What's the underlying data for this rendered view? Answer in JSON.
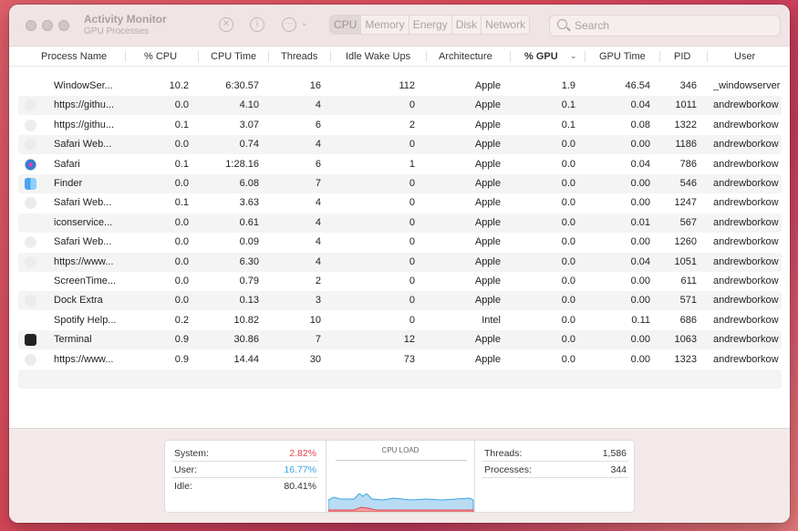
{
  "window": {
    "title": "Activity Monitor",
    "subtitle": "GPU Processes"
  },
  "toolbar": {
    "stop_icon": "x-circle-icon",
    "info_icon": "info-icon",
    "more_icon": "ellipsis-circle-icon",
    "tabs": [
      {
        "label": "CPU",
        "active": true
      },
      {
        "label": "Memory"
      },
      {
        "label": "Energy"
      },
      {
        "label": "Disk"
      },
      {
        "label": "Network"
      }
    ],
    "search_placeholder": "Search"
  },
  "columns": [
    "Process Name",
    "% CPU",
    "CPU Time",
    "Threads",
    "Idle Wake Ups",
    "Architecture",
    "% GPU",
    "GPU Time",
    "PID",
    "User"
  ],
  "sort_column": "% GPU",
  "rows": [
    {
      "icon": "none",
      "name": "WindowSer...",
      "cpu": "10.2",
      "cpu_time": "6:30.57",
      "threads": "16",
      "idle": "112",
      "arch": "Apple",
      "gpu": "1.9",
      "gpu_time": "46.54",
      "pid": "346",
      "user": "_windowserver"
    },
    {
      "icon": "generic-app-icon",
      "name": "https://githu...",
      "cpu": "0.0",
      "cpu_time": "4.10",
      "threads": "4",
      "idle": "0",
      "arch": "Apple",
      "gpu": "0.1",
      "gpu_time": "0.04",
      "pid": "1011",
      "user": "andrewborkow"
    },
    {
      "icon": "generic-app-icon",
      "name": "https://githu...",
      "cpu": "0.1",
      "cpu_time": "3.07",
      "threads": "6",
      "idle": "2",
      "arch": "Apple",
      "gpu": "0.1",
      "gpu_time": "0.08",
      "pid": "1322",
      "user": "andrewborkow"
    },
    {
      "icon": "generic-app-icon",
      "name": "Safari Web...",
      "cpu": "0.0",
      "cpu_time": "0.74",
      "threads": "4",
      "idle": "0",
      "arch": "Apple",
      "gpu": "0.0",
      "gpu_time": "0.00",
      "pid": "1186",
      "user": "andrewborkow"
    },
    {
      "icon": "safari-icon",
      "name": "Safari",
      "cpu": "0.1",
      "cpu_time": "1:28.16",
      "threads": "6",
      "idle": "1",
      "arch": "Apple",
      "gpu": "0.0",
      "gpu_time": "0.04",
      "pid": "786",
      "user": "andrewborkow"
    },
    {
      "icon": "finder-icon",
      "name": "Finder",
      "cpu": "0.0",
      "cpu_time": "6.08",
      "threads": "7",
      "idle": "0",
      "arch": "Apple",
      "gpu": "0.0",
      "gpu_time": "0.00",
      "pid": "546",
      "user": "andrewborkow"
    },
    {
      "icon": "generic-app-icon",
      "name": "Safari Web...",
      "cpu": "0.1",
      "cpu_time": "3.63",
      "threads": "4",
      "idle": "0",
      "arch": "Apple",
      "gpu": "0.0",
      "gpu_time": "0.00",
      "pid": "1247",
      "user": "andrewborkow"
    },
    {
      "icon": "none",
      "name": "iconservice...",
      "cpu": "0.0",
      "cpu_time": "0.61",
      "threads": "4",
      "idle": "0",
      "arch": "Apple",
      "gpu": "0.0",
      "gpu_time": "0.01",
      "pid": "567",
      "user": "andrewborkow"
    },
    {
      "icon": "generic-app-icon",
      "name": "Safari Web...",
      "cpu": "0.0",
      "cpu_time": "0.09",
      "threads": "4",
      "idle": "0",
      "arch": "Apple",
      "gpu": "0.0",
      "gpu_time": "0.00",
      "pid": "1260",
      "user": "andrewborkow"
    },
    {
      "icon": "generic-app-icon",
      "name": "https://www...",
      "cpu": "0.0",
      "cpu_time": "6.30",
      "threads": "4",
      "idle": "0",
      "arch": "Apple",
      "gpu": "0.0",
      "gpu_time": "0.04",
      "pid": "1051",
      "user": "andrewborkow"
    },
    {
      "icon": "none",
      "name": "ScreenTime...",
      "cpu": "0.0",
      "cpu_time": "0.79",
      "threads": "2",
      "idle": "0",
      "arch": "Apple",
      "gpu": "0.0",
      "gpu_time": "0.00",
      "pid": "611",
      "user": "andrewborkow"
    },
    {
      "icon": "generic-app-icon",
      "name": "Dock Extra",
      "cpu": "0.0",
      "cpu_time": "0.13",
      "threads": "3",
      "idle": "0",
      "arch": "Apple",
      "gpu": "0.0",
      "gpu_time": "0.00",
      "pid": "571",
      "user": "andrewborkow"
    },
    {
      "icon": "none",
      "name": "Spotify Help...",
      "cpu": "0.2",
      "cpu_time": "10.82",
      "threads": "10",
      "idle": "0",
      "arch": "Intel",
      "gpu": "0.0",
      "gpu_time": "0.11",
      "pid": "686",
      "user": "andrewborkow"
    },
    {
      "icon": "terminal-icon",
      "name": "Terminal",
      "cpu": "0.9",
      "cpu_time": "30.86",
      "threads": "7",
      "idle": "12",
      "arch": "Apple",
      "gpu": "0.0",
      "gpu_time": "0.00",
      "pid": "1063",
      "user": "andrewborkow"
    },
    {
      "icon": "generic-app-icon",
      "name": "https://www...",
      "cpu": "0.9",
      "cpu_time": "14.44",
      "threads": "30",
      "idle": "73",
      "arch": "Apple",
      "gpu": "0.0",
      "gpu_time": "0.00",
      "pid": "1323",
      "user": "andrewborkow"
    }
  ],
  "summary": {
    "system_label": "System:",
    "system": "2.82%",
    "user_label": "User:",
    "user": "16.77%",
    "idle_label": "Idle:",
    "idle": "80.41%",
    "chart_title": "CPU LOAD",
    "threads_label": "Threads:",
    "threads": "1,586",
    "processes_label": "Processes:",
    "processes": "344",
    "colors": {
      "system": "#e0484f",
      "user": "#3aa6e0"
    }
  }
}
